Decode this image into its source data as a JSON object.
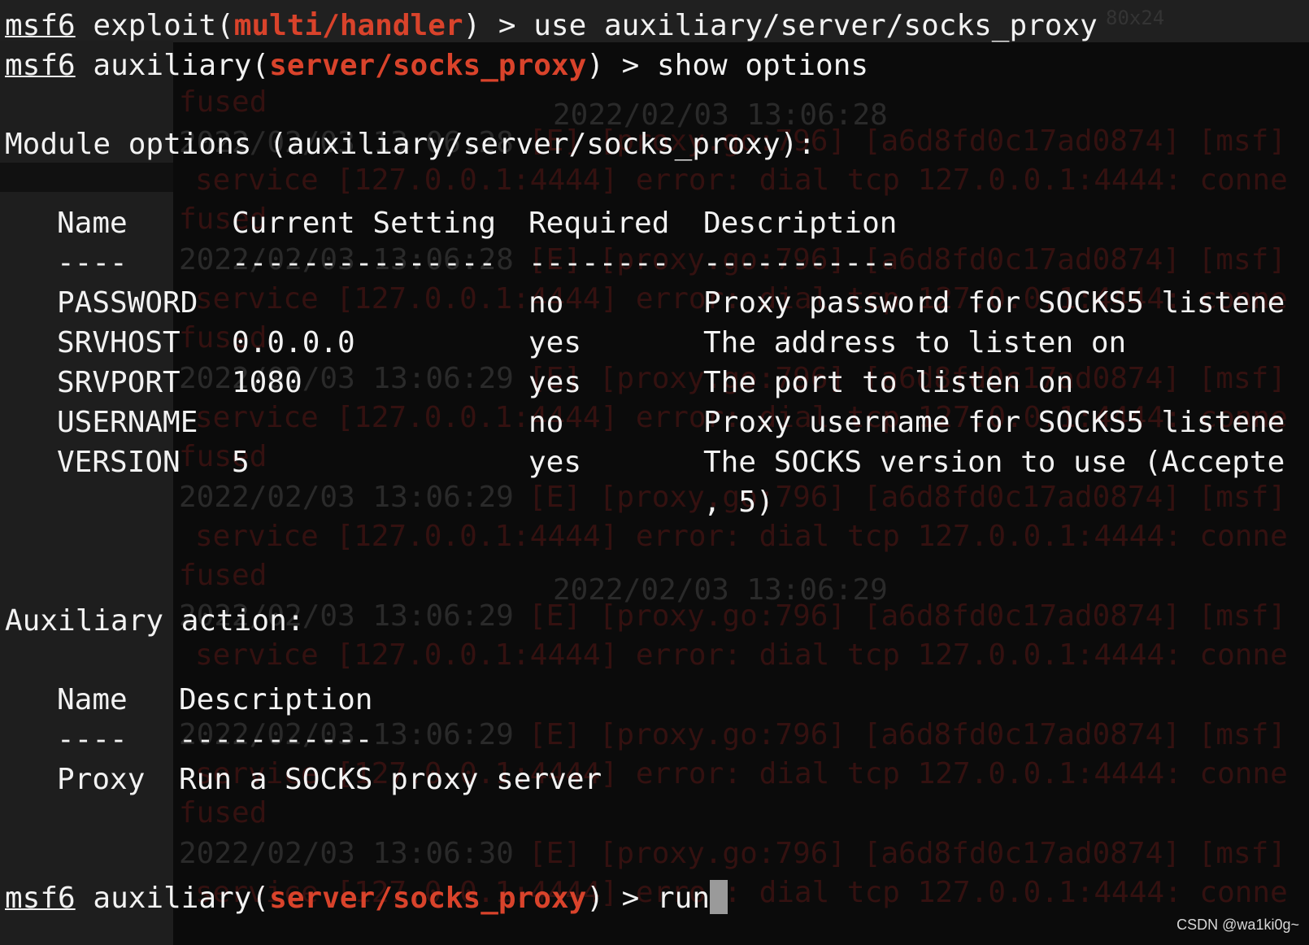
{
  "prompt": {
    "name": "msf6",
    "line1": {
      "context_label": "exploit(",
      "module": "multi/handler",
      "suffix": ") > ",
      "command": "use auxiliary/server/socks_proxy"
    },
    "line2": {
      "context_label": "auxiliary(",
      "module": "server/socks_proxy",
      "suffix": ") > ",
      "command": "show options"
    },
    "last": {
      "context_label": "auxiliary(",
      "module": "server/socks_proxy",
      "suffix": ") > ",
      "command": "run"
    }
  },
  "module_options": {
    "heading": "Module options (auxiliary/server/socks_proxy):",
    "columns": [
      "Name",
      "Current Setting",
      "Required",
      "Description"
    ],
    "underlines": [
      "----",
      "---------------",
      "--------",
      "-----------"
    ],
    "rows": [
      {
        "name": "PASSWORD",
        "current": "",
        "required": "no",
        "description": "Proxy password for SOCKS5 listene"
      },
      {
        "name": "SRVHOST",
        "current": "0.0.0.0",
        "required": "yes",
        "description": "The address to listen on"
      },
      {
        "name": "SRVPORT",
        "current": "1080",
        "required": "yes",
        "description": "The port to listen on"
      },
      {
        "name": "USERNAME",
        "current": "",
        "required": "no",
        "description": "Proxy username for SOCKS5 listene"
      },
      {
        "name": "VERSION",
        "current": "5",
        "required": "yes",
        "description": "The SOCKS version to use (Accepte"
      }
    ],
    "wrap_continuation": ", 5)"
  },
  "auxiliary_action": {
    "heading": "Auxiliary action:",
    "columns": [
      "Name",
      "Description"
    ],
    "underlines": [
      "----",
      "-----------"
    ],
    "rows": [
      {
        "name": "Proxy",
        "description": "Run a SOCKS proxy server"
      }
    ]
  },
  "background_log": {
    "timestamps": [
      "2022/02/03 13:06:28",
      "2022/02/03 13:06:28",
      "2022/02/03 13:06:29",
      "2022/02/03 13:06:29",
      "2022/02/03 13:06:29",
      "2022/02/03 13:06:29",
      "2022/02/03 13:06:30"
    ],
    "error_prefix": "[E] [proxy.go:796] [a6d8fd0c17ad0874] [msf]",
    "service_error": "service [127.0.0.1:4444] error: dial tcp 127.0.0.1:4444: conne",
    "fused": "fused",
    "size_hint": "80x24"
  },
  "watermark": "CSDN @wa1ki0g~",
  "colors": {
    "module_red": "#d9432b",
    "text": "#f2f2f2",
    "background": "#0b0b0b"
  }
}
